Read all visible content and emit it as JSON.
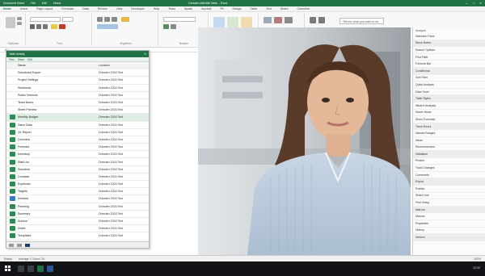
{
  "window": {
    "title": "Dresden Aktivität Table – Excel",
    "left_items": [
      "Document Home",
      "File",
      "Edit",
      "Home"
    ],
    "controls": [
      "—",
      "□",
      "✕"
    ]
  },
  "ribbon": {
    "tabs": [
      "Home",
      "Insert",
      "Page Layout",
      "Formulas",
      "Data",
      "Review",
      "View",
      "Developer",
      "Help",
      "Team",
      "Speak",
      "Acrobat",
      "Fit",
      "Design",
      "Table",
      "Sort",
      "Share",
      "Comment"
    ],
    "active_tab": "Home",
    "groups": [
      "Clipboard",
      "Font",
      "Alignment",
      "Number",
      "Styles",
      "Cells",
      "Editing"
    ],
    "search_placeholder": "Tell me what you want to do"
  },
  "formula_bar": {
    "name_box": "A1"
  },
  "pane": {
    "title": "Table Activity",
    "tabs": [
      "Files",
      "Share",
      "Edit"
    ],
    "header_row": {
      "name": "Name",
      "value": "Location"
    },
    "rows": [
      {
        "name": "Scheduled Export",
        "value": "Dresden 2016 Test",
        "icon": "none"
      },
      {
        "name": "Project Settings",
        "value": "Dresden 2016 Test",
        "icon": "none"
      },
      {
        "name": "Workbook",
        "value": "Dresden 2016 Test",
        "icon": "none"
      },
      {
        "name": "Public Versions",
        "value": "Dresden 2016 Test",
        "icon": "none"
      },
      {
        "name": "Team Notes",
        "value": "Dresden 2016 Test",
        "icon": "none"
      },
      {
        "name": "Sheet Preview",
        "value": "Dresden 2016 Test",
        "icon": "none"
      },
      {
        "name": "Monthly Budget",
        "value": "Dresden 2016 Test",
        "icon": "green"
      },
      {
        "name": "Sales Data",
        "value": "Dresden 2016 Test",
        "icon": "green"
      },
      {
        "name": "Q1 Report",
        "value": "Dresden 2016 Test",
        "icon": "green"
      },
      {
        "name": "Overview",
        "value": "Dresden 2016 Test",
        "icon": "green"
      },
      {
        "name": "Forecast",
        "value": "Dresden 2016 Test",
        "icon": "green"
      },
      {
        "name": "Inventory",
        "value": "Dresden 2016 Test",
        "icon": "green"
      },
      {
        "name": "Staff List",
        "value": "Dresden 2016 Test",
        "icon": "green"
      },
      {
        "name": "Schedule",
        "value": "Dresden 2016 Test",
        "icon": "green"
      },
      {
        "name": "Contacts",
        "value": "Dresden 2016 Test",
        "icon": "green"
      },
      {
        "name": "Expenses",
        "value": "Dresden 2016 Test",
        "icon": "green"
      },
      {
        "name": "Targets",
        "value": "Dresden 2016 Test",
        "icon": "green"
      },
      {
        "name": "Invoices",
        "value": "Dresden 2016 Test",
        "icon": "blue"
      },
      {
        "name": "Planning",
        "value": "Dresden 2016 Test",
        "icon": "green"
      },
      {
        "name": "Summary",
        "value": "Dresden 2016 Test",
        "icon": "green"
      },
      {
        "name": "Archive",
        "value": "Dresden 2016 Test",
        "icon": "green"
      },
      {
        "name": "Notes",
        "value": "Dresden 2016 Test",
        "icon": "green"
      },
      {
        "name": "Templates",
        "value": "Dresden 2016 Test",
        "icon": "green"
      },
      {
        "name": "Draft",
        "value": "Dresden 2016 Test",
        "icon": "green"
      }
    ]
  },
  "right_panel": {
    "header": "Analyze",
    "items": [
      "Selection Pane",
      "Show Notes",
      "Search Options",
      "Find Filter",
      "Formula Bar",
      "Conditional",
      "Sort Filter",
      "Quick Analysis",
      "Data Tools",
      "Table Styles",
      "What-If Analysis",
      "Sheet Views",
      "Show Formulas",
      "Trace Errors",
      "Named Ranges",
      "Ideas",
      "Recommended",
      "Validation",
      "Protect",
      "Track Changes",
      "Comments",
      "Export",
      "Publish",
      "Share Link",
      "Print Setup",
      "Add-ins",
      "Macros",
      "Properties",
      "History",
      "Version"
    ]
  },
  "status": {
    "left": "Ready",
    "mid": "Average: 0  Count: 24",
    "right": "100%"
  },
  "taskbar": {
    "tray": "12:00"
  }
}
